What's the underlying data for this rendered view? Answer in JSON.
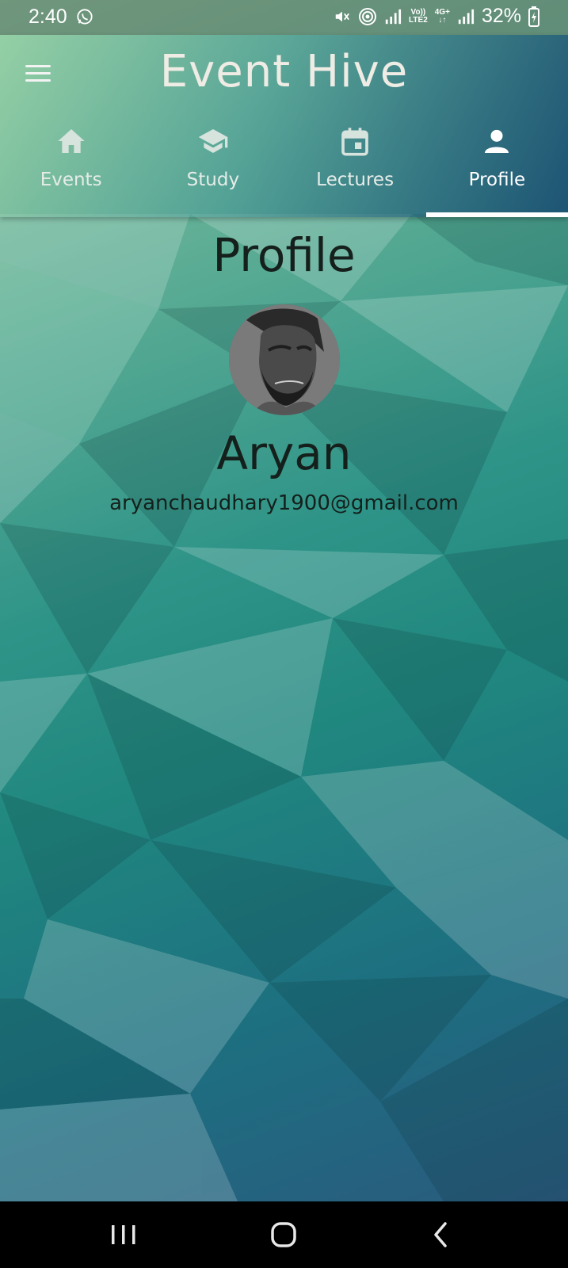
{
  "status_bar": {
    "time": "2:40",
    "app_icon": "whatsapp-icon",
    "network_volte": "Vo))",
    "network_lte": "LTE2",
    "network_4g": "4G+",
    "battery": "32%",
    "icons": [
      "mute-icon",
      "hotspot-icon",
      "signal-icon",
      "signal-icon",
      "battery-charging-icon"
    ]
  },
  "header": {
    "title": "Event Hive",
    "menu_icon": "hamburger-menu-icon"
  },
  "tabs": [
    {
      "label": "Events",
      "icon": "home-icon",
      "active": false
    },
    {
      "label": "Study",
      "icon": "graduation-cap-icon",
      "active": false
    },
    {
      "label": "Lectures",
      "icon": "calendar-icon",
      "active": false
    },
    {
      "label": "Profile",
      "icon": "person-icon",
      "active": true
    }
  ],
  "profile": {
    "page_title": "Profile",
    "name": "Aryan",
    "email": "aryanchaudhary1900@gmail.com"
  },
  "nav_bar": {
    "buttons": [
      "recent-apps-icon",
      "home-button-icon",
      "back-icon"
    ]
  },
  "colors": {
    "text_dark": "#15201c",
    "tab_indicator": "#ffffff",
    "bg_top": "#8cc9a0",
    "bg_bottom": "#2a5a7e"
  }
}
